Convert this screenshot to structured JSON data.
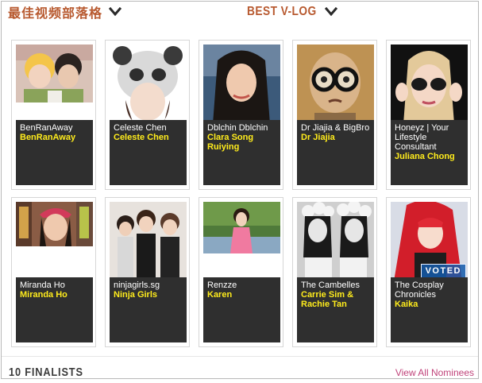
{
  "header": {
    "left_title": "最佳视频部落格",
    "right_title": "BEST V-LOG"
  },
  "nominees": [
    {
      "name": "BenRanAway",
      "real_name": "BenRanAway"
    },
    {
      "name": "Celeste Chen",
      "real_name": "Celeste Chen"
    },
    {
      "name": "Dblchin Dblchin",
      "real_name": "Clara Song Ruiying"
    },
    {
      "name": "Dr Jiajia & BigBro",
      "real_name": "Dr Jiajia"
    },
    {
      "name": "Honeyz | Your Lifestyle Consultant",
      "real_name": "Juliana Chong"
    },
    {
      "name": "Miranda Ho",
      "real_name": "Miranda Ho"
    },
    {
      "name": "ninjagirls.sg",
      "real_name": "Ninja Girls"
    },
    {
      "name": "Renzze",
      "real_name": "Karen"
    },
    {
      "name": "The Cambelles",
      "real_name": "Carrie Sim & Rachie Tan"
    },
    {
      "name": "The Cosplay Chronicles",
      "real_name": "Kaika",
      "badge": "VOTED"
    }
  ],
  "footer": {
    "title": "10 FINALISTS",
    "link_label": "View All Nominees"
  },
  "colors": {
    "accent": "#b85a30",
    "caption_bg": "#2f2f2f",
    "highlight": "#ffec1c",
    "link": "#c0437a"
  }
}
